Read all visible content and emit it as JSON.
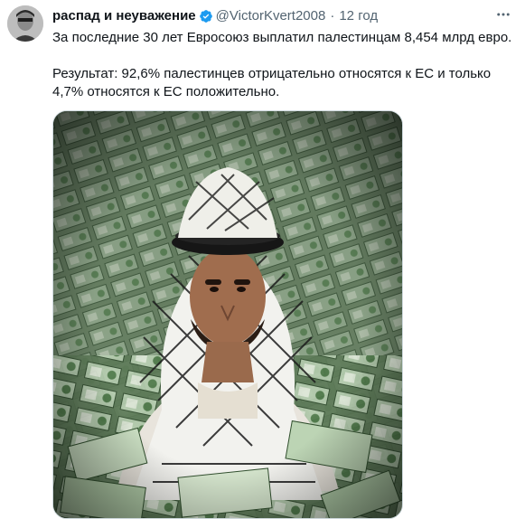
{
  "tweet": {
    "display_name": "распад и неуважение",
    "handle": "@VictorKvert2008",
    "separator": "·",
    "time": "12 год",
    "paragraph_1": "За последние 30 лет Евросоюз выплатил палестинцам 8,454 млрд евро.",
    "paragraph_2": "Результат: 92,6% палестинцев отрицательно относятся к ЕС и только 4,7% относятся к ЕС положительно."
  },
  "icons": {
    "verified": "verified-badge-icon",
    "more": "more-options-icon"
  },
  "colors": {
    "verified_blue": "#1d9bf0",
    "secondary_text": "#536471",
    "primary_text": "#0f1419"
  }
}
